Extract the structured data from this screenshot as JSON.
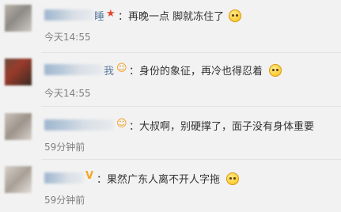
{
  "comments": [
    {
      "name_tail": "睡",
      "badge": "★",
      "badge_icon": "red-star-icon",
      "text": "：再晚一点 脚就冻住了",
      "emoji": "doge-emoji-icon",
      "time": "今天14:55"
    },
    {
      "name_tail": "我",
      "badge": "☺",
      "badge_icon": "smiley-badge-icon",
      "text": "：身份的象征，再冷也得忍着",
      "emoji": "doge-emoji-icon",
      "time": "今天14:55"
    },
    {
      "name_tail": "",
      "badge": "☺",
      "badge_icon": "smiley-badge-icon",
      "text": "：大叔啊，别硬撑了，面子没有身体重要",
      "emoji": "",
      "time": "59分钟前"
    },
    {
      "name_tail": "",
      "badge": "V",
      "badge_icon": "yellow-v-badge-icon",
      "text": "：果然广东人离不开人字拖",
      "emoji": "doge-emoji-icon",
      "time": "59分钟前"
    }
  ],
  "colors": {
    "background": "#f2f2f2",
    "text": "#333333",
    "time": "#808080",
    "name": "#5d7d9f",
    "star": "#e8452c",
    "v_badge": "#f5a623"
  }
}
